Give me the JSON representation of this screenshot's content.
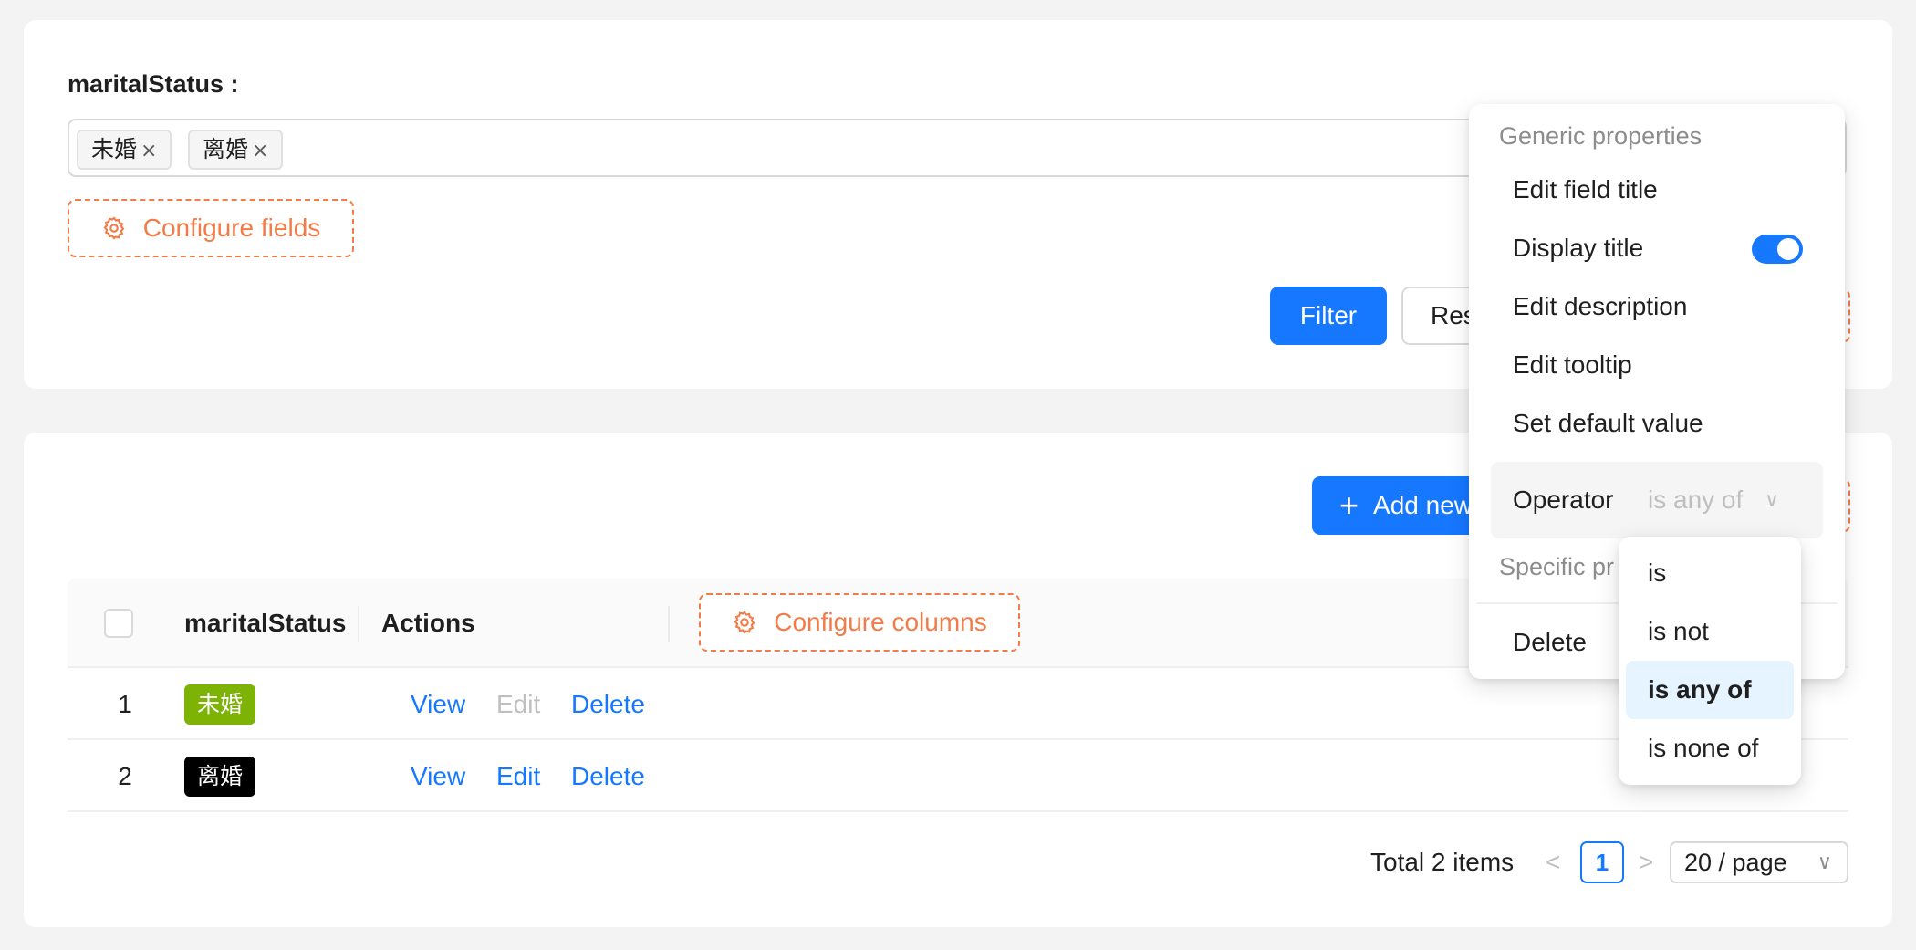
{
  "filter": {
    "field_label": "maritalStatus :",
    "selected_tags": [
      "未婚",
      "离婚"
    ],
    "tag_remove": "×",
    "configure_fields": "Configure fields",
    "filter_button": "Filter",
    "reset_button": "Res"
  },
  "table": {
    "add_new": "Add new",
    "plus": "+",
    "columns": [
      "maritalStatus",
      "Actions"
    ],
    "configure_columns": "Configure columns",
    "rows": [
      {
        "num": "1",
        "status": "未婚",
        "status_color": "#7cb305",
        "actions": [
          "View",
          "Edit",
          "Delete"
        ],
        "edit_disabled": true
      },
      {
        "num": "2",
        "status": "离婚",
        "status_color": "#000000",
        "actions": [
          "View",
          "Edit",
          "Delete"
        ],
        "edit_disabled": false
      }
    ],
    "pagination": {
      "total": "Total 2 items",
      "prev": "<",
      "current": "1",
      "next": ">",
      "page_size": "20 / page",
      "page_size_chevron": "∨"
    }
  },
  "settings_menu": {
    "generic_header": "Generic properties",
    "items": [
      "Edit field title",
      "Display title",
      "Edit description",
      "Edit tooltip",
      "Set default value"
    ],
    "display_title_on": true,
    "operator_label": "Operator",
    "operator_value": "is any of",
    "operator_chevron": "∨",
    "specific_header": "Specific pr",
    "delete": "Delete"
  },
  "operator_options": {
    "options": [
      "is",
      "is not",
      "is any of",
      "is none of"
    ],
    "selected": "is any of"
  },
  "colors": {
    "primary": "#1677ff",
    "dashed_accent": "#f37b47"
  }
}
